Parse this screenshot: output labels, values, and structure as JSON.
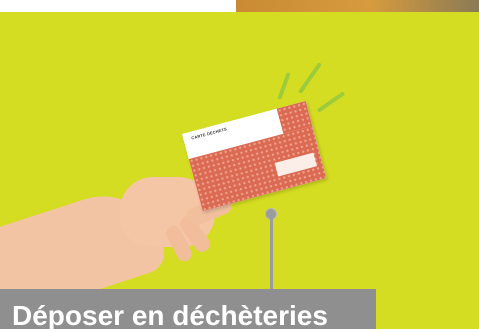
{
  "colors": {
    "panel_background": "#d4dd21",
    "card_accent": "#db6a52",
    "label_background": "#8f8f8f",
    "label_text": "#ffffff"
  },
  "card": {
    "title": "CARTE DÉCHETS"
  },
  "caption": {
    "text": "Déposer en déchèteries"
  }
}
